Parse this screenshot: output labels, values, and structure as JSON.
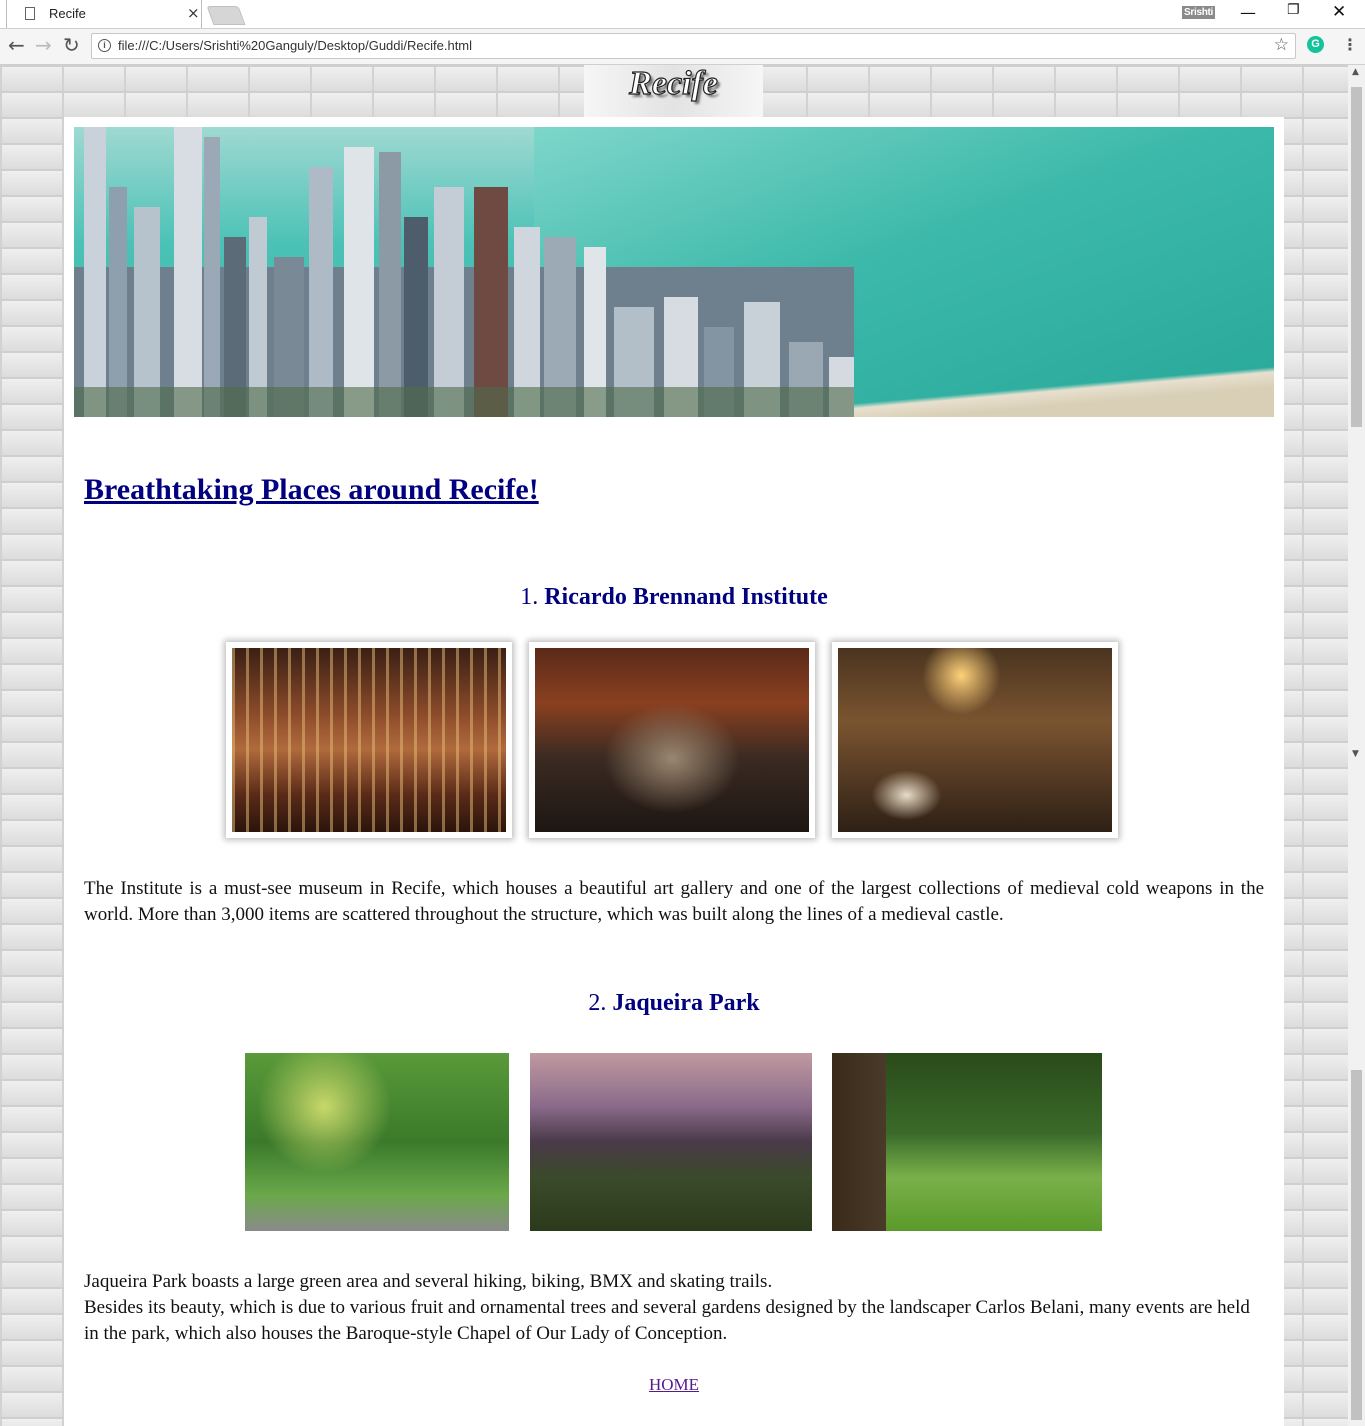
{
  "browser": {
    "tab_title": "Recife",
    "tab_close": "×",
    "profile_name": "Srishti",
    "window_min": "—",
    "window_max": "❐",
    "window_close": "✕",
    "nav_back": "←",
    "nav_forward": "→",
    "nav_reload": "↻",
    "info": "i",
    "url": "file:///C:/Users/Srishti%20Ganguly/Desktop/Guddi/Recife.html",
    "star": "☆",
    "extension_letter": "G",
    "menu": "⋮"
  },
  "page": {
    "logo_text": "Recife",
    "heading": "Breathtaking Places around Recife!",
    "sections": [
      {
        "number": "1.",
        "title": "Ricardo Brennand Institute",
        "description": "The Institute is a must-see museum in Recife, which houses a beautiful art gallery and one of the largest collections of medieval cold weapons in the world. More than 3,000 items are scattered throughout the structure, which was built along the lines of a medieval castle."
      },
      {
        "number": "2.",
        "title": "Jaqueira Park",
        "description_line1": "Jaqueira Park boasts a large green area and several hiking, biking, BMX and skating trails.",
        "description_line2": "Besides its beauty, which is due to various fruit and ornamental trees and several gardens designed by the landscaper Carlos Belani, many events are held in the park, which also houses the Baroque-style Chapel of Our Lady of Conception."
      }
    ],
    "home_link": "HOME"
  },
  "colors": {
    "heading": "#000080",
    "link_visited": "#551a8b"
  }
}
